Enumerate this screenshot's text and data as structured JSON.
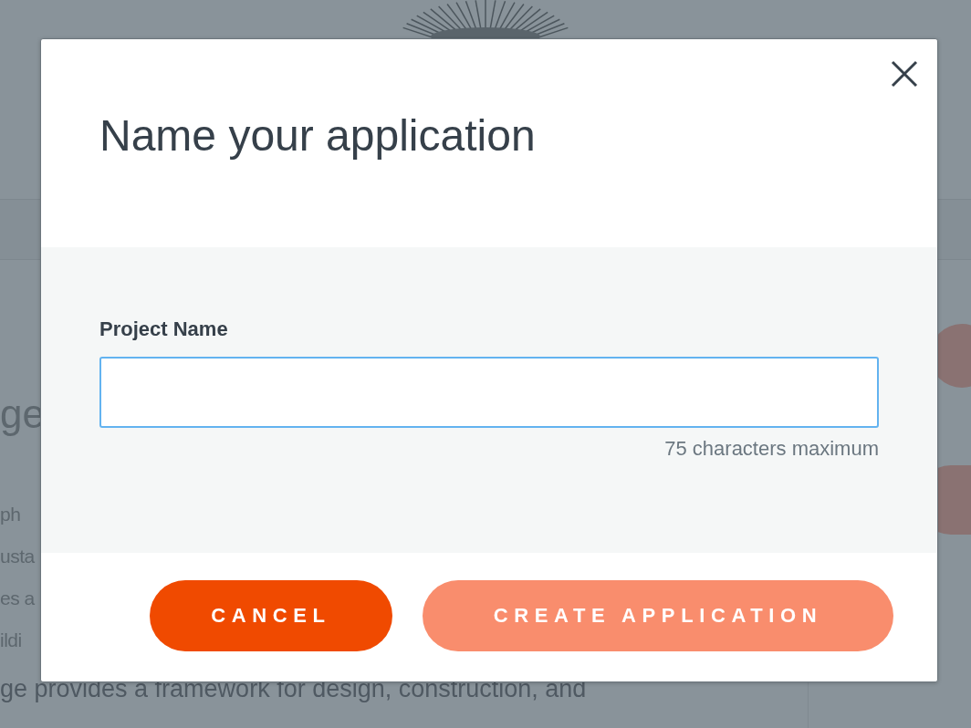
{
  "background": {
    "heading_fragment": "ge",
    "text_fragments": [
      "ph",
      "usta",
      "es a",
      "ildi"
    ],
    "bottom_line": "ge provides a framework for design, construction, and"
  },
  "dialog": {
    "title": "Name your application",
    "field": {
      "label": "Project Name",
      "hint": "75 characters maximum",
      "focused": true
    },
    "buttons": [
      {
        "label": "CANCEL",
        "kind": "secondary",
        "disabled": false
      },
      {
        "label": "CREATE APPLICATION",
        "kind": "primary",
        "disabled": true
      }
    ]
  }
}
